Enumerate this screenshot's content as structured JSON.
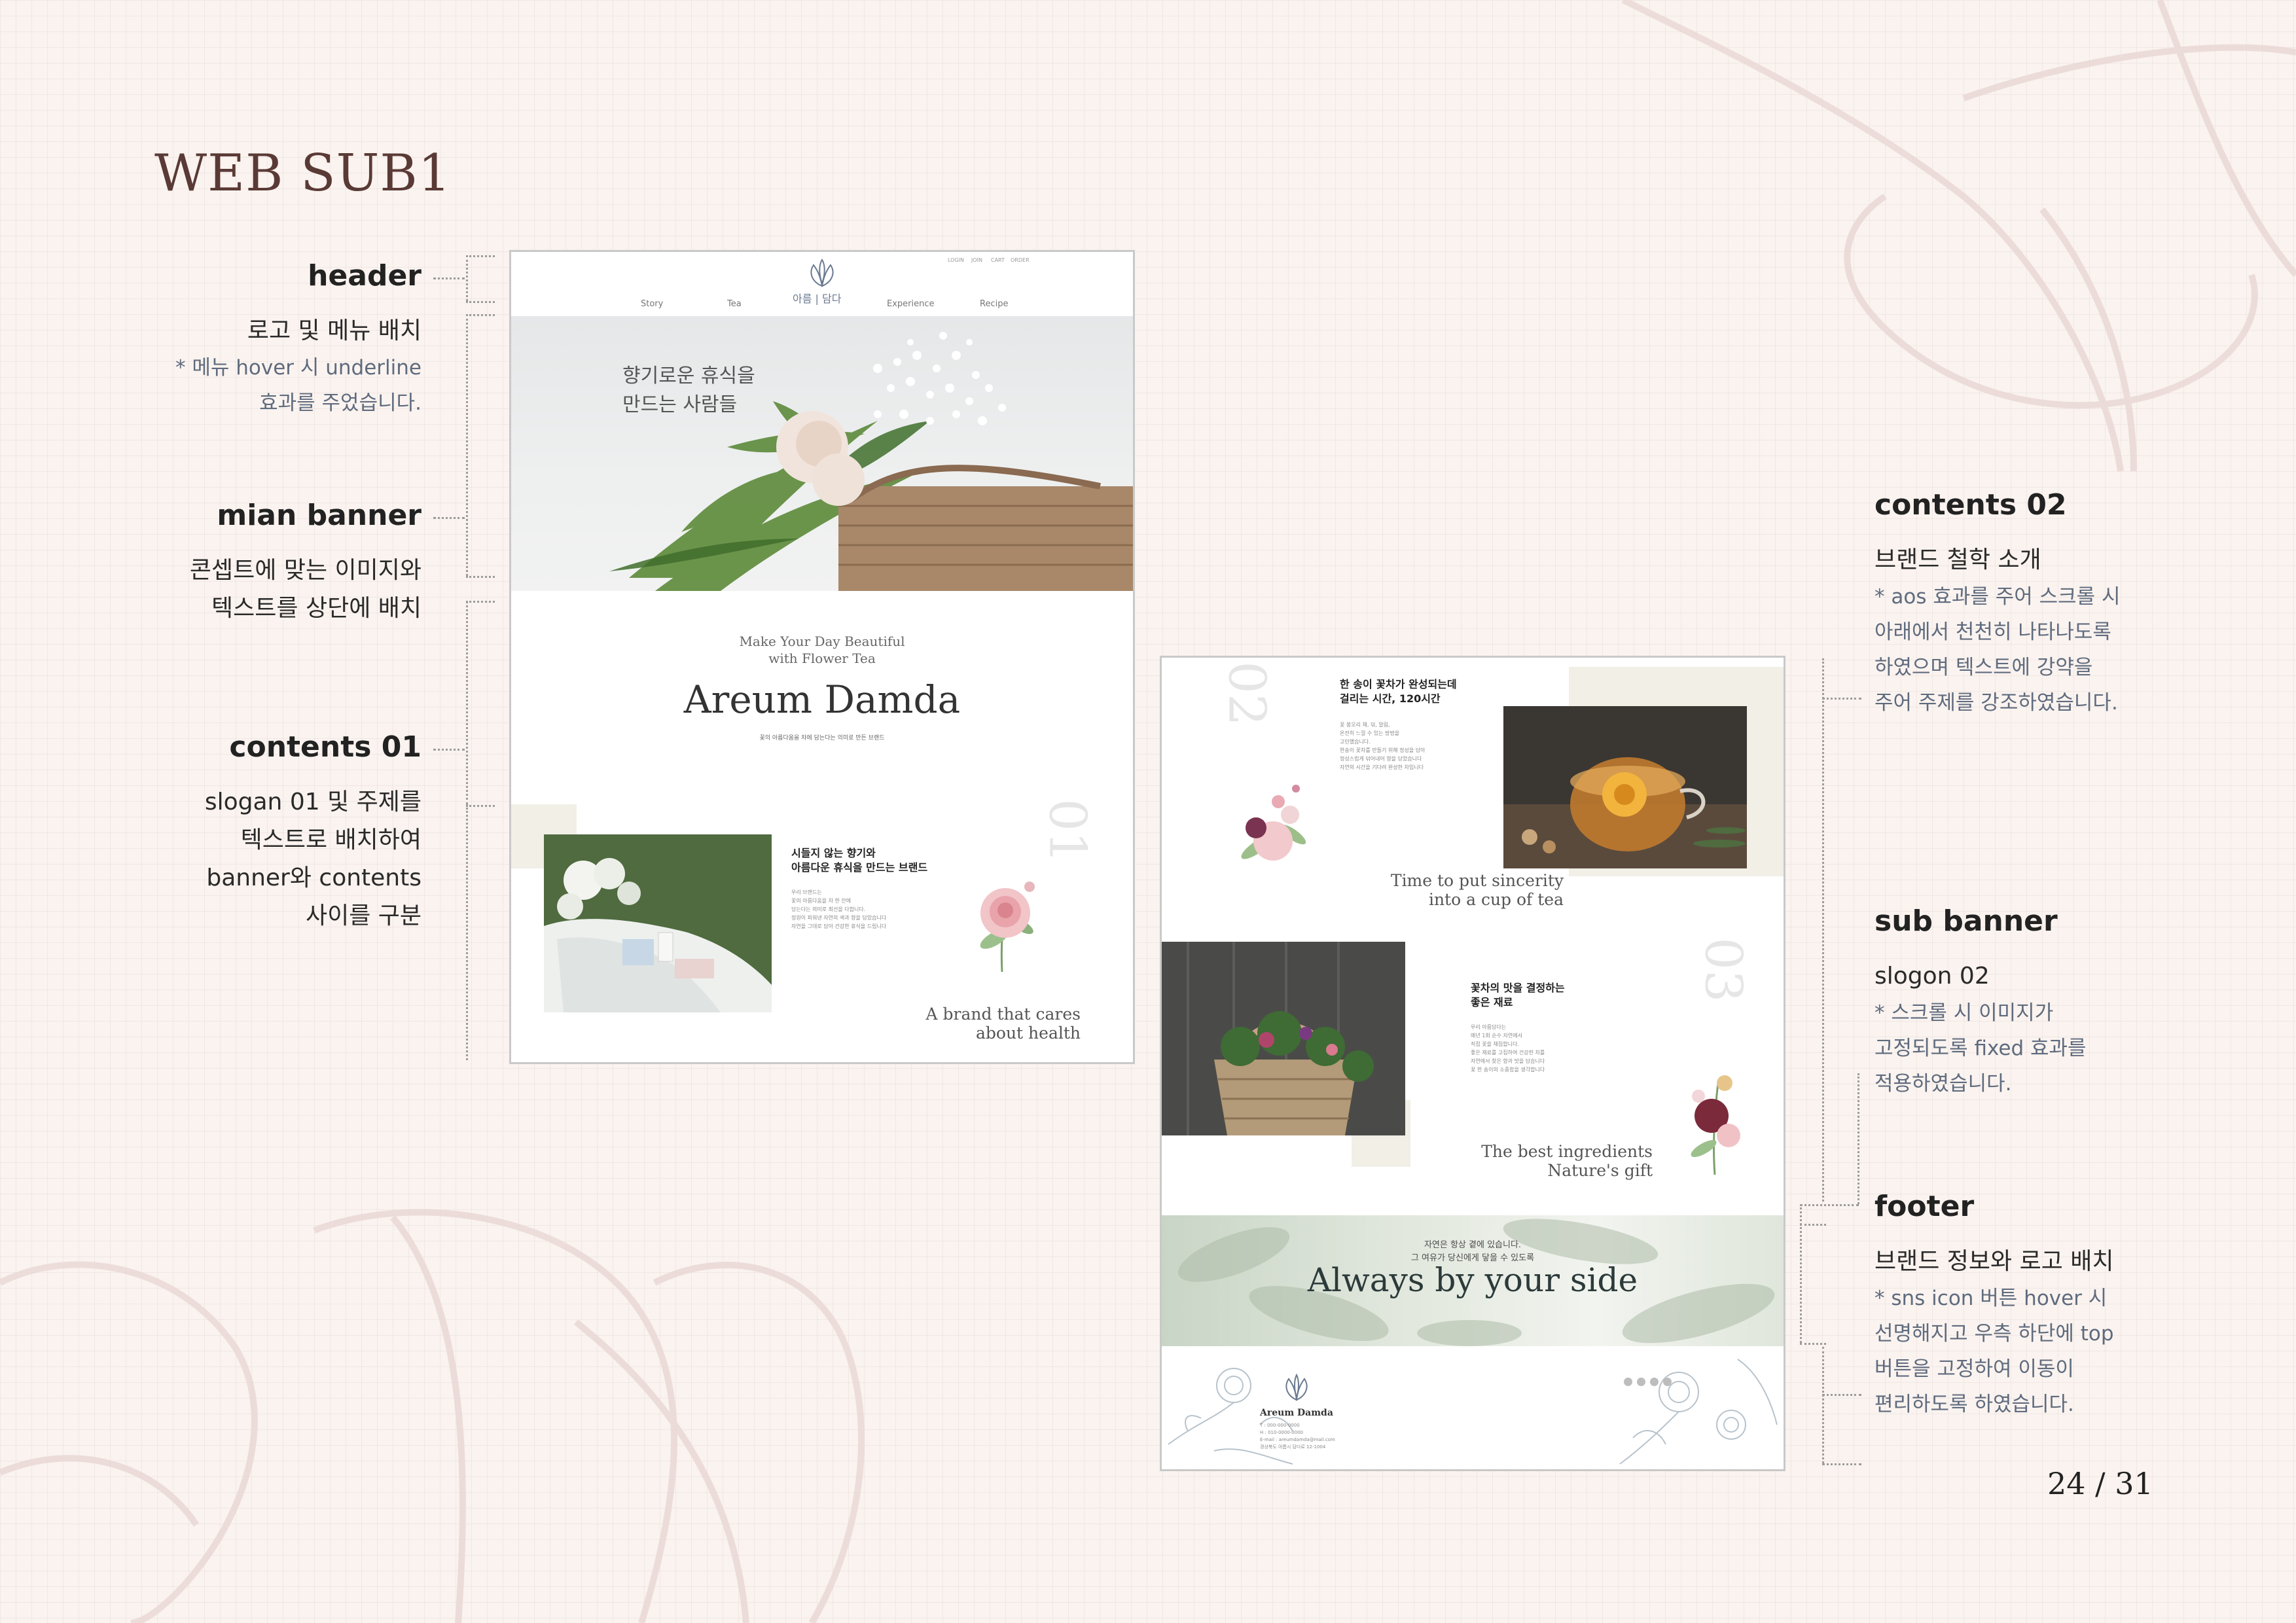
{
  "page": {
    "title": "WEB SUB1",
    "page_number": "24 / 31"
  },
  "annotations_left": [
    {
      "head": "header",
      "main": [
        "로고 및 메뉴 배치"
      ],
      "note": [
        "* 메뉴 hover 시 underline",
        "효과를 주었습니다."
      ]
    },
    {
      "head": "mian banner",
      "main": [
        "콘셉트에 맞는 이미지와",
        "텍스트를 상단에 배치"
      ],
      "note": []
    },
    {
      "head": "contents 01",
      "main": [
        "slogan 01 및 주제를",
        "텍스트로 배치하여",
        "banner와 contents",
        "사이를 구분"
      ],
      "note": []
    }
  ],
  "annotations_right": [
    {
      "head": "contents 02",
      "main": [
        "브랜드 철학 소개"
      ],
      "note": [
        "* aos 효과를 주어 스크롤 시",
        "아래에서 천천히 나타나도록",
        "하였으며 텍스트에 강약을",
        "주어 주제를 강조하였습니다."
      ]
    },
    {
      "head": "sub banner",
      "main": [
        "slogon 02"
      ],
      "note": [
        "* 스크롤 시 이미지가",
        "고정되도록 fixed 효과를",
        "적용하였습니다."
      ]
    },
    {
      "head": "footer",
      "main": [
        "브랜드 정보와 로고 배치"
      ],
      "note": [
        "* sns icon 버튼 hover 시",
        "선명해지고 우측 하단에 top",
        "버튼을 고정하여 이동이",
        "편리하도록 하였습니다."
      ]
    }
  ],
  "mockup1": {
    "util_links": [
      "LOGIN",
      "JOIN",
      "CART",
      "ORDER"
    ],
    "nav": [
      "Story",
      "Tea",
      "Experience",
      "Recipe"
    ],
    "logo_text": "아름 | 담다",
    "banner_text": [
      "향기로운 휴식을",
      "만드는 사람들"
    ],
    "slogan_small": [
      "Make Your Day Beautiful",
      "with Flower Tea"
    ],
    "slogan_big": "Areum Damda",
    "slogan_tiny": "꽃의 아름다움을 차에 담는다는 의미로 만든 브랜드",
    "num": "01",
    "ko_head": [
      "시들지 않는 향기와",
      "아름다운 휴식을 만드는 브랜드"
    ],
    "ko_body": [
      "우리 브랜드는",
      "꽃의 아름다움을 차 한 잔에",
      "담는다는 의미로 최선을 다합니다.",
      "",
      "정원이 피워낸 자연의 색과 향을 담았습니다",
      "자연을 그대로 담아 건강한 휴식을 드립니다"
    ],
    "en_sub": [
      "A brand that cares",
      "about health"
    ]
  },
  "mockup2": {
    "num02": "02",
    "c02_head": [
      "한 송이 꽃차가 완성되는데",
      "걸리는 시간, 120시간"
    ],
    "c02_body": [
      "꽃 봉오리 채, 덖, 말림,",
      "온전히 느낄 수 있는 방법을",
      "고민했습니다.",
      "",
      "한송이 꽃차를 만들기 위해 정성을 담아",
      "정성스럽게 덖어내어 향을 담았습니다",
      "자연의 시간을 기다려 완성한 차입니다"
    ],
    "c02_en": [
      "Time to put sincerity",
      "into a cup of tea"
    ],
    "num03": "03",
    "c03_head": [
      "꽃차의 맛을 결정하는",
      "좋은 재료"
    ],
    "c03_body": [
      "우리 아름담다는",
      "매년 1회 순수 자연에서",
      "직접 꽃을 채집합니다.",
      "",
      "좋은 재료를 고집하여 건강한 차를",
      "자연에서 찾은 향과 맛을 담습니다",
      "꽃 한 송이의 소중함을 생각합니다"
    ],
    "c03_en": [
      "The best ingredients",
      "Nature's gift"
    ],
    "sub_small": [
      "자연은 항상 곁에 있습니다.",
      "그 여유가 당신에게 닿을 수 있도록"
    ],
    "sub_big": "Always by your side",
    "footer_brand": "Areum Damda",
    "footer_info": [
      "T : 000-000-0000",
      "H : 010-0000-0000",
      "E-mail : areumdamda@mail.com",
      "경상북도 아름시 담다로 12-1004"
    ]
  }
}
